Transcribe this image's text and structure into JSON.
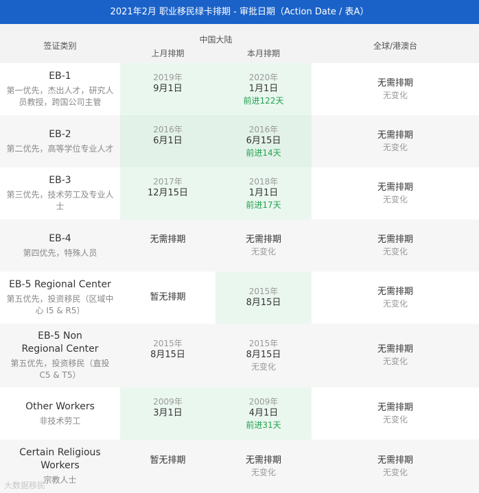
{
  "title": "2021年2月 职业移民绿卡排期 - 审批日期（Action Date / 表A）",
  "header": {
    "category": "签证类别",
    "china": "中国大陆",
    "prev": "上月排期",
    "curr": "本月排期",
    "global": "全球/港澳台"
  },
  "rows": [
    {
      "name": "EB-1",
      "desc": "第一优先，杰出人才，研究人员教授，跨国公司主管",
      "prev": {
        "year": "2019年",
        "date": "9月1日"
      },
      "curr": {
        "year": "2020年",
        "date": "1月1日",
        "change": "前进122天"
      },
      "global": {
        "status": "无需排期",
        "change": "无变化"
      }
    },
    {
      "name": "EB-2",
      "desc": "第二优先，高等学位专业人才",
      "prev": {
        "year": "2016年",
        "date": "6月1日"
      },
      "curr": {
        "year": "2016年",
        "date": "6月15日",
        "change": "前进14天"
      },
      "global": {
        "status": "无需排期",
        "change": "无变化"
      }
    },
    {
      "name": "EB-3",
      "desc": "第三优先，技术劳工及专业人士",
      "prev": {
        "year": "2017年",
        "date": "12月15日"
      },
      "curr": {
        "year": "2018年",
        "date": "1月1日",
        "change": "前进17天"
      },
      "global": {
        "status": "无需排期",
        "change": "无变化"
      }
    },
    {
      "name": "EB-4",
      "desc": "第四优先，特殊人员",
      "prev": {
        "status": "无需排期"
      },
      "curr": {
        "status": "无需排期",
        "nochange": "无变化"
      },
      "global": {
        "status": "无需排期",
        "change": "无变化"
      }
    },
    {
      "name": "EB-5 Regional Center",
      "desc": "第五优先，投资移民（区域中心 I5 & R5）",
      "prev": {
        "status": "暂无排期"
      },
      "curr": {
        "year": "2015年",
        "date": "8月15日"
      },
      "global": {
        "status": "无需排期",
        "change": "无变化"
      }
    },
    {
      "name": "EB-5 Non Regional Center",
      "desc": "第五优先，投资移民（直投 C5 & T5）",
      "prev": {
        "year": "2015年",
        "date": "8月15日"
      },
      "curr": {
        "year": "2015年",
        "date": "8月15日",
        "nochange": "无变化"
      },
      "global": {
        "status": "无需排期",
        "change": "无变化"
      }
    },
    {
      "name": "Other Workers",
      "desc": "非技术劳工",
      "prev": {
        "year": "2009年",
        "date": "3月1日"
      },
      "curr": {
        "year": "2009年",
        "date": "4月1日",
        "change": "前进31天"
      },
      "global": {
        "status": "无需排期",
        "change": "无变化"
      }
    },
    {
      "name": "Certain Religious Workers",
      "desc": "宗教人士",
      "prev": {
        "status": "暂无排期"
      },
      "curr": {
        "status": "无需排期",
        "nochange": "无变化"
      },
      "global": {
        "status": "无需排期",
        "change": "无变化"
      }
    }
  ],
  "watermark": "大数据移民"
}
